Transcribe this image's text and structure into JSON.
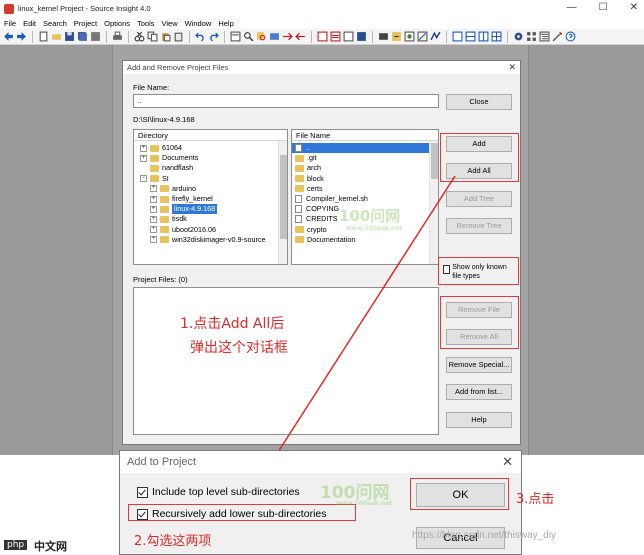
{
  "app": {
    "title": "linux_kernel Project - Source Insight 4.0",
    "controls": [
      "—",
      "☐",
      "✕"
    ],
    "menu": [
      "File",
      "Edit",
      "Search",
      "Project",
      "Options",
      "Tools",
      "View",
      "Window",
      "Help"
    ]
  },
  "add_remove_dialog": {
    "title": "Add and Remove Project Files",
    "close_glyph": "✕",
    "file_name_label": "File Name:",
    "file_name_value": "..",
    "current_path": "D:\\SI\\linux-4.9.168",
    "directory_header": "Directory",
    "directories": [
      {
        "name": "61064",
        "level": 1,
        "expander": "+"
      },
      {
        "name": "Documents",
        "level": 1,
        "expander": "+"
      },
      {
        "name": "nandflash",
        "level": 1,
        "expander": ""
      },
      {
        "name": "SI",
        "level": 1,
        "expander": "−"
      },
      {
        "name": "arduino",
        "level": 2,
        "expander": "+"
      },
      {
        "name": "firefly_kernel",
        "level": 2,
        "expander": "+"
      },
      {
        "name": "linux-4.9.168",
        "level": 2,
        "expander": "+",
        "selected": true
      },
      {
        "name": "tisdk",
        "level": 2,
        "expander": "+"
      },
      {
        "name": "uboot2016.06",
        "level": 2,
        "expander": "+"
      },
      {
        "name": "win32diskimager-v0.9-source",
        "level": 2,
        "expander": "+"
      }
    ],
    "file_header": "File Name",
    "files": [
      {
        "name": "..",
        "kind": "doc",
        "selected": true
      },
      {
        "name": ".git",
        "kind": "folder"
      },
      {
        "name": "arch",
        "kind": "folder"
      },
      {
        "name": "block",
        "kind": "folder"
      },
      {
        "name": "certs",
        "kind": "folder"
      },
      {
        "name": "Compiler_kernel.sh",
        "kind": "doc"
      },
      {
        "name": "COPYING",
        "kind": "doc"
      },
      {
        "name": "CREDITS",
        "kind": "doc"
      },
      {
        "name": "crypto",
        "kind": "folder"
      },
      {
        "name": "Documentation",
        "kind": "folder"
      }
    ],
    "project_files_label": "Project Files: (0)",
    "show_known_label": "Show only known file types",
    "buttons": {
      "close": "Close",
      "add": "Add",
      "add_all": "Add All",
      "add_tree": "Add Tree",
      "remove_tree": "Remove Tree",
      "remove_file": "Remove File",
      "remove_all": "Remove All",
      "remove_special": "Remove Special...",
      "add_from_list": "Add from list...",
      "help": "Help"
    }
  },
  "add_to_project_dialog": {
    "title": "Add to Project",
    "close_glyph": "✕",
    "include_top_label": "Include top level sub-directories",
    "include_top_checked": true,
    "recursive_label": "Recursively add lower sub-directories",
    "recursive_checked": true,
    "ok": "OK",
    "cancel": "Cancel"
  },
  "annotations": {
    "step1_line1": "1.点击Add All后",
    "step1_line2": "弹出这个对话框",
    "step2": "2.勾选这两项",
    "step3": "3.点击",
    "color": "#e02a2a"
  },
  "watermarks": {
    "top": "100问网",
    "top_url": "www.100ask.net",
    "bottom": "100问网",
    "bottom_url": "www.100ask.net",
    "csdn": "https://blog.csdn.net/thisway_diy",
    "logo_php": "php",
    "logo_cn": "中文网"
  }
}
